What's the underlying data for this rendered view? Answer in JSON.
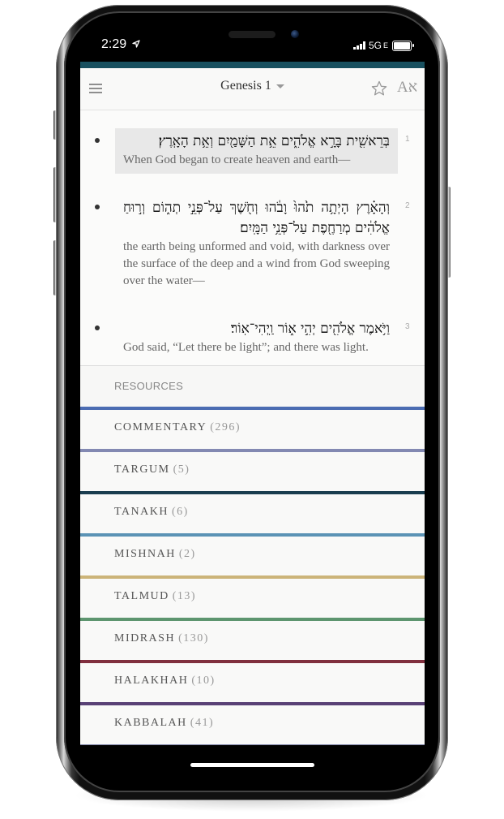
{
  "status_bar": {
    "time": "2:29",
    "location_icon": "location-arrow-icon",
    "network": "5G",
    "network_suffix": "E",
    "battery_icon": "battery-icon"
  },
  "colors": {
    "top_bar": "#18505f",
    "highlight": "#e8e8e8"
  },
  "header": {
    "menu_icon": "hamburger-menu-icon",
    "title": "Genesis 1",
    "dropdown_icon": "caret-down-icon",
    "bookmark_icon": "star-icon",
    "language_label": "Aא"
  },
  "verses": [
    {
      "number": "1",
      "hebrew": "בְּרֵאשִׁ֖ית בָּרָ֣א אֱלֹהִ֑ים אֵ֥ת הַשָּׁמַ֖יִם וְאֵ֥ת הָאָֽרֶץ׃",
      "english": "When God began to create heaven and earth—",
      "highlighted": true
    },
    {
      "number": "2",
      "hebrew": "וְהָאָ֗רֶץ הָיְתָ֥ה תֹ֙הוּ֙ וָבֹ֔הוּ וְחֹ֖שֶׁךְ עַל־פְּנֵ֣י תְה֑וֹם וְר֣וּחַ אֱלֹהִ֔ים מְרַחֶ֖פֶת עַל־פְּנֵ֥י הַמָּֽיִם׃",
      "english": "the earth being unformed and void, with darkness over the surface of the deep and a wind from God sweeping over the water—",
      "highlighted": false
    },
    {
      "number": "3",
      "hebrew": "וַיֹּ֥אמֶר אֱלֹהִ֖ים יְהִ֣י א֑וֹר וַֽיְהִי־אֽוֹר׃",
      "english": "God said, “Let there be light”; and there was light.",
      "highlighted": false
    }
  ],
  "resources": {
    "title": "RESOURCES",
    "items": [
      {
        "label": "COMMENTARY",
        "count": "(296)",
        "color": "#4b6cb2"
      },
      {
        "label": "TARGUM",
        "count": "(5)",
        "color": "#8389b2"
      },
      {
        "label": "TANAKH",
        "count": "(6)",
        "color": "#1a3d4f"
      },
      {
        "label": "MISHNAH",
        "count": "(2)",
        "color": "#5b93b5"
      },
      {
        "label": "TALMUD",
        "count": "(13)",
        "color": "#ccb479"
      },
      {
        "label": "MIDRASH",
        "count": "(130)",
        "color": "#5d956f"
      },
      {
        "label": "HALAKHAH",
        "count": "(10)",
        "color": "#802f3e"
      },
      {
        "label": "KABBALAH",
        "count": "(41)",
        "color": "#594176"
      },
      {
        "label": "",
        "count": "",
        "color": "#7f85a9"
      }
    ]
  }
}
